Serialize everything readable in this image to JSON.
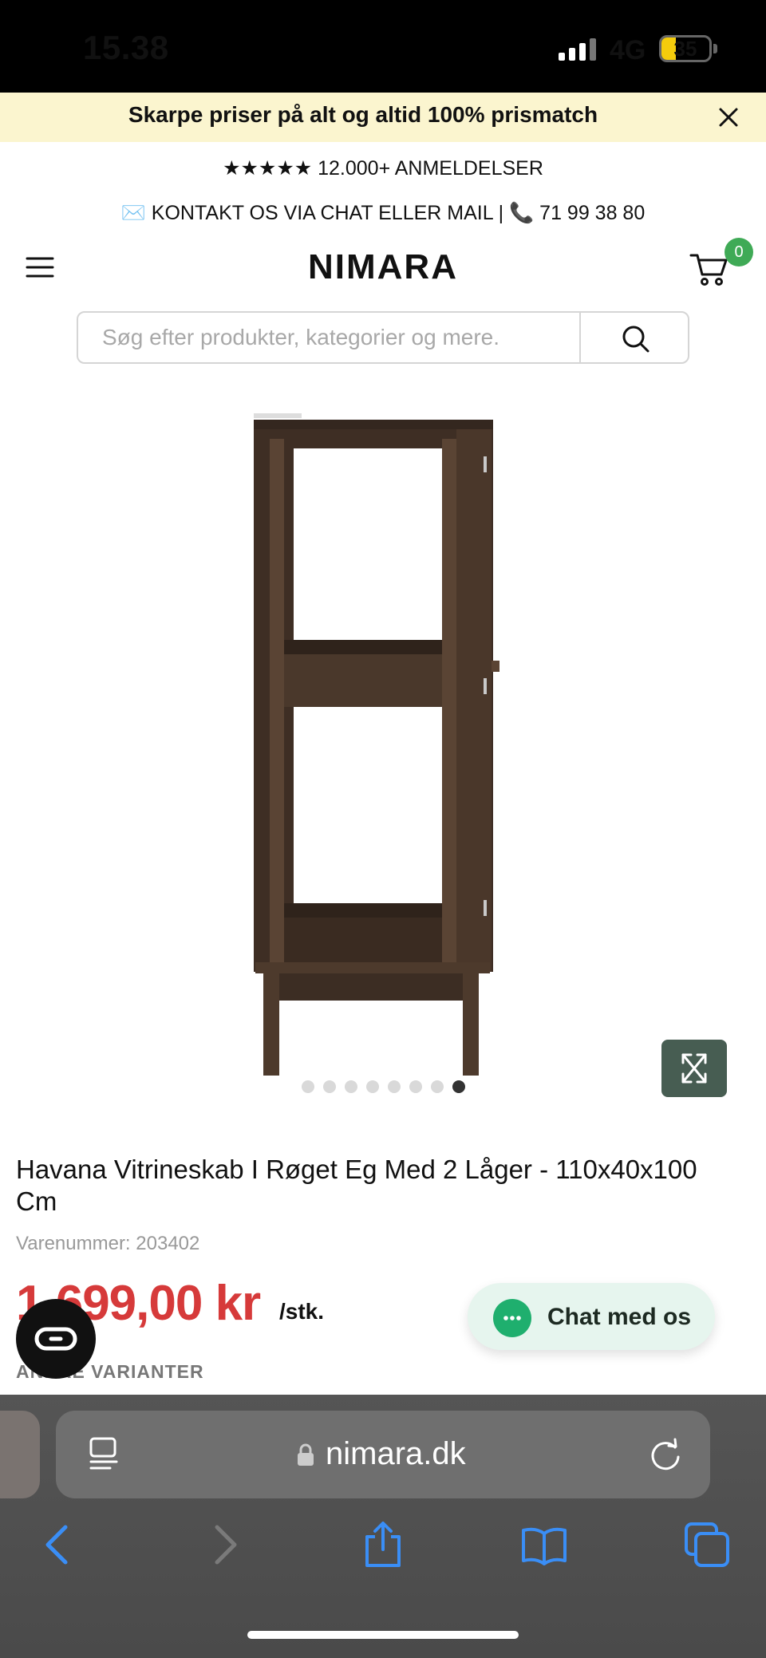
{
  "status_bar": {
    "time": "15.38",
    "network": "4G",
    "battery": "35"
  },
  "promo": {
    "text": "Skarpe priser på alt og altid 100% prismatch"
  },
  "info": {
    "reviews": "★★★★★ 12.000+ ANMELDELSER",
    "contact": "✉️ KONTAKT OS VIA CHAT ELLER MAIL | 📞 71 99 38 80"
  },
  "header": {
    "logo": "NIMARA",
    "cart_count": "0"
  },
  "search": {
    "placeholder": "Søg efter produkter, kategorier og mere."
  },
  "gallery": {
    "image_count": 8,
    "active_index": 7
  },
  "product": {
    "title": "Havana Vitrineskab I Røget Eg Med 2 Låger - 110x40x100 Cm",
    "sku": "Varenummer: 203402",
    "price": "1.699,00 kr",
    "unit": "/stk.",
    "variants_label": "ANDRE VARIANTER"
  },
  "chat": {
    "label": "Chat med os"
  },
  "browser": {
    "url": "nimara.dk"
  },
  "colors": {
    "price": "#d63a3a",
    "accent": "#3faa56",
    "promo_bg": "#fbf5cf",
    "expand_bg": "#475d52",
    "safari_blue": "#3a8ef6"
  }
}
